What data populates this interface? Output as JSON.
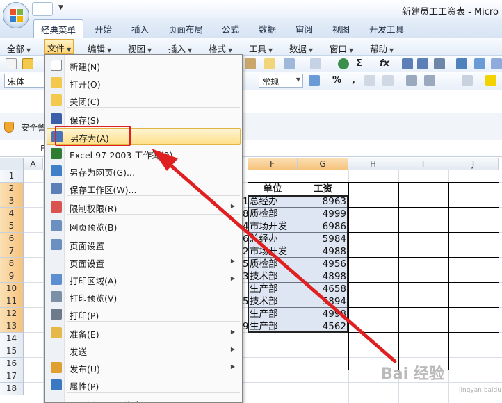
{
  "window": {
    "title": "新建员工工资表 - Micro"
  },
  "ribbon_tabs": [
    "经典菜单",
    "开始",
    "插入",
    "页面布局",
    "公式",
    "数据",
    "审阅",
    "视图",
    "开发工具"
  ],
  "menu_strip": [
    "全部",
    "文件",
    "编辑",
    "视图",
    "插入",
    "格式",
    "工具",
    "数据",
    "窗口",
    "帮助"
  ],
  "toolbar": {
    "font_name": "宋体",
    "number_format": "常规",
    "sigma": "Σ",
    "fx": "fx",
    "percent": "%",
    "comma": ","
  },
  "security_bar": {
    "text": "安全警"
  },
  "formula_bar": {
    "partial": "E"
  },
  "columns": [
    "A",
    "F",
    "G",
    "H",
    "I",
    "J"
  ],
  "rows": [
    "1",
    "2",
    "3",
    "4",
    "5",
    "6",
    "7",
    "8",
    "9",
    "10",
    "11",
    "12",
    "13",
    "14",
    "15",
    "16",
    "17",
    "18"
  ],
  "sheet": {
    "header_dept": "单位",
    "header_salary": "工资",
    "rows": [
      {
        "prefix": "1",
        "dept": "总经办",
        "salary": "8963"
      },
      {
        "prefix": "8",
        "dept": "质检部",
        "salary": "4999"
      },
      {
        "prefix": "4",
        "dept": "市场开发",
        "salary": "6986"
      },
      {
        "prefix": "6",
        "dept": "总经办",
        "salary": "5984"
      },
      {
        "prefix": "2",
        "dept": "市场开发",
        "salary": "4988"
      },
      {
        "prefix": "5",
        "dept": "质检部",
        "salary": "4956"
      },
      {
        "prefix": "3",
        "dept": "技术部",
        "salary": "4898"
      },
      {
        "prefix": "",
        "dept": "生产部",
        "salary": "4658"
      },
      {
        "prefix": "5",
        "dept": "技术部",
        "salary": "5894"
      },
      {
        "prefix": "",
        "dept": "生产部",
        "salary": "4998"
      },
      {
        "prefix": "9",
        "dept": "生产部",
        "salary": "4562"
      }
    ]
  },
  "file_menu": {
    "items": [
      {
        "label": "新建(N)",
        "icon": "new-doc-icon",
        "submenu": false
      },
      {
        "label": "打开(O)",
        "icon": "open-folder-icon",
        "submenu": false
      },
      {
        "label": "关闭(C)",
        "icon": "close-folder-icon",
        "submenu": false
      },
      {
        "label": "保存(S)",
        "icon": "save-disk-icon",
        "submenu": false
      },
      {
        "label": "另存为(A)",
        "icon": "save-as-icon",
        "submenu": false
      },
      {
        "label": "Excel 97-2003 工作簿(9)",
        "icon": "excel-workbook-icon",
        "submenu": false
      },
      {
        "label": "另存为网页(G)...",
        "icon": "save-web-icon",
        "submenu": false
      },
      {
        "label": "保存工作区(W)...",
        "icon": "workspace-icon",
        "submenu": false
      },
      {
        "label": "限制权限(R)",
        "icon": "permission-icon",
        "submenu": true
      },
      {
        "label": "网页预览(B)",
        "icon": "web-preview-icon",
        "submenu": false
      },
      {
        "label": "页面设置",
        "icon": "page-setup-icon",
        "submenu": false
      },
      {
        "label": "页面设置",
        "icon": "",
        "submenu": true
      },
      {
        "label": "打印区域(A)",
        "icon": "print-area-icon",
        "submenu": true
      },
      {
        "label": "打印预览(V)",
        "icon": "print-preview-icon",
        "submenu": false
      },
      {
        "label": "打印(P)",
        "icon": "printer-icon",
        "submenu": false
      },
      {
        "label": "准备(E)",
        "icon": "prepare-icon",
        "submenu": true
      },
      {
        "label": "发送",
        "icon": "",
        "submenu": true
      },
      {
        "label": "发布(U)",
        "icon": "publish-icon",
        "submenu": true
      },
      {
        "label": "属性(P)",
        "icon": "properties-icon",
        "submenu": false
      },
      {
        "label": "1: 新建员工工资表.xlsx",
        "icon": "",
        "submenu": false
      }
    ],
    "highlighted": "另存为(A)"
  },
  "watermark": {
    "text": "Bai 经验",
    "sub": "jingyan.baidu.com"
  },
  "colors": {
    "annotation_red": "#e02020",
    "menu_highlight": "#ffe08a",
    "selected_header": "#f6c37d"
  }
}
